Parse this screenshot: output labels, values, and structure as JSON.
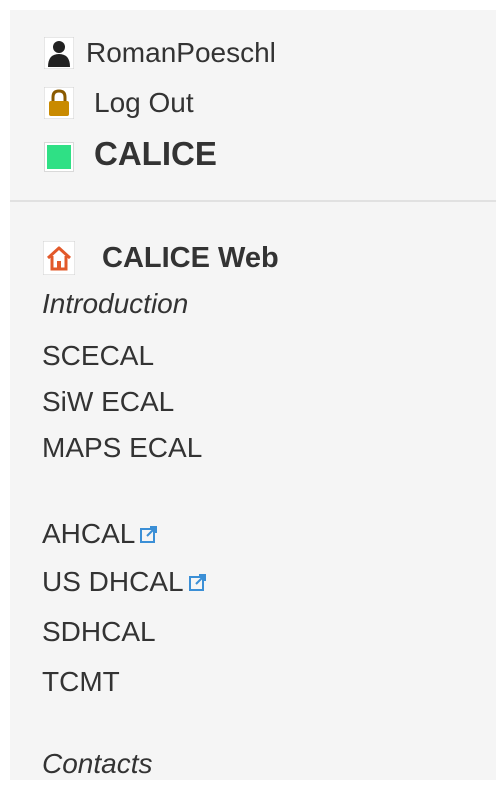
{
  "user": {
    "name": "RomanPoeschl",
    "logout_label": "Log Out",
    "web_label": "CALICE",
    "web_color": "#2fe085"
  },
  "menu": {
    "home_label": "CALICE Web",
    "home_icon": "home-icon",
    "items": [
      {
        "label": "Introduction",
        "style": "italic"
      },
      {
        "label": "SCECAL"
      },
      {
        "label": "SiW ECAL"
      },
      {
        "label": "MAPS ECAL"
      },
      {
        "label": "AHCAL",
        "external": true
      },
      {
        "label": "US DHCAL",
        "external": true
      },
      {
        "label": "SDHCAL"
      },
      {
        "label": "TCMT"
      },
      {
        "label": "Contacts",
        "style": "italic"
      }
    ]
  },
  "colors": {
    "panel_bg": "#f5f5f5",
    "text": "#333333",
    "home_icon_color": "#e2592a",
    "external_icon_color": "#3b8fd6"
  }
}
